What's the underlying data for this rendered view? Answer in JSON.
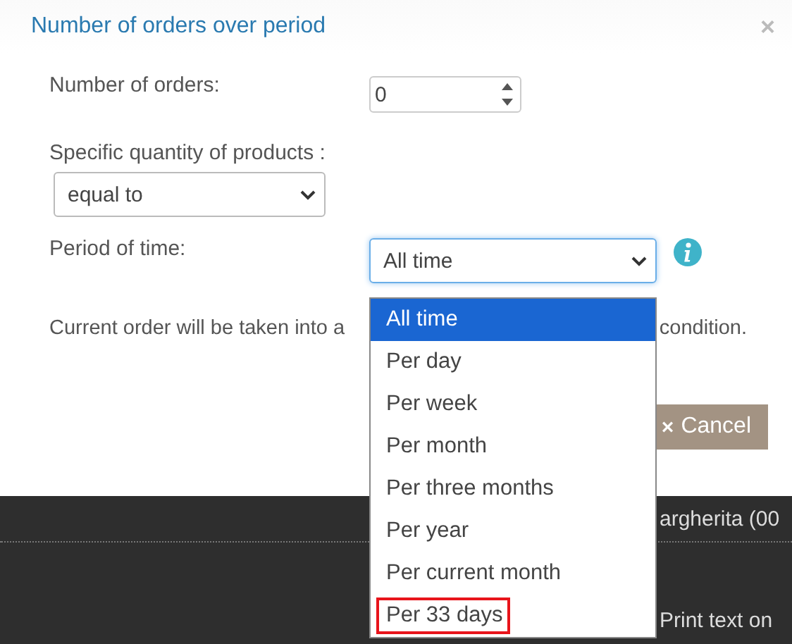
{
  "dialog": {
    "title": "Number of orders over period",
    "close": "×",
    "orders": {
      "label": "Number of orders:",
      "value": "0"
    },
    "quantity": {
      "label": "Specific quantity of products :",
      "value": "equal to"
    },
    "period": {
      "label": "Period of time:",
      "value": "All time",
      "expanded": true
    },
    "note": [
      "Current order will be taken into a",
      "condition."
    ],
    "buttons": [
      {
        "label": "Cancel",
        "icon": "×"
      }
    ]
  },
  "dropdown": {
    "options": [
      {
        "label": "All time",
        "selected": true,
        "highlighted": false
      },
      {
        "label": "Per day",
        "selected": false,
        "highlighted": false
      },
      {
        "label": "Per week",
        "selected": false,
        "highlighted": false
      },
      {
        "label": "Per month",
        "selected": false,
        "highlighted": false
      },
      {
        "label": "Per three months",
        "selected": false,
        "highlighted": false
      },
      {
        "label": "Per year",
        "selected": false,
        "highlighted": false
      },
      {
        "label": "Per current month",
        "selected": false,
        "highlighted": false
      },
      {
        "label": "Per 33 days",
        "selected": false,
        "highlighted": true
      }
    ]
  },
  "background": {
    "rows": [
      "argherita (00",
      "Print text on"
    ]
  }
}
